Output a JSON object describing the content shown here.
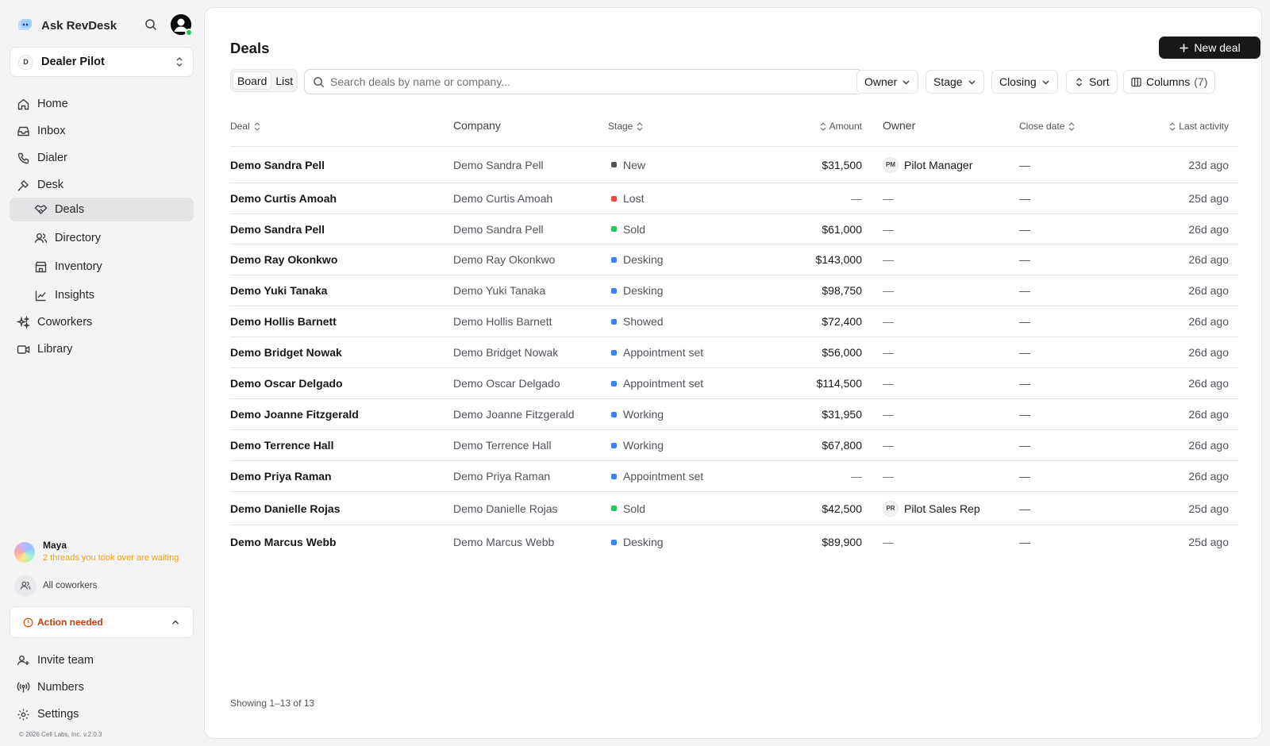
{
  "app": {
    "name": "Ask RevDesk"
  },
  "workspace": {
    "initial": "D",
    "name": "Dealer Pilot"
  },
  "nav": {
    "home": "Home",
    "inbox": "Inbox",
    "dialer": "Dialer",
    "desk": "Desk",
    "deals": "Deals",
    "directory": "Directory",
    "inventory": "Inventory",
    "insights": "Insights",
    "coworkers": "Coworkers",
    "library": "Library"
  },
  "coworker": {
    "name": "Maya",
    "status": "2 threads you took over are waiting"
  },
  "all_coworkers": "All coworkers",
  "action_needed": "Action needed",
  "footer_nav": {
    "invite": "Invite team",
    "numbers": "Numbers",
    "settings": "Settings"
  },
  "copyright": "© 2026 Cell Labs, Inc. v.2.0.3",
  "page": {
    "title": "Deals",
    "new_deal": "New deal",
    "view_board": "Board",
    "view_list": "List",
    "search_placeholder": "Search deals by name or company...",
    "filters": {
      "owner": "Owner",
      "stage": "Stage",
      "closing": "Closing",
      "sort": "Sort",
      "columns": "Columns",
      "columns_count": "(7)"
    }
  },
  "table": {
    "headers": {
      "deal": "Deal",
      "company": "Company",
      "stage": "Stage",
      "amount": "Amount",
      "owner": "Owner",
      "close_date": "Close date",
      "last_activity": "Last activity"
    },
    "rows": [
      {
        "deal": "Demo Sandra Pell",
        "company": "Demo Sandra Pell",
        "stage": "New",
        "stage_color": "#52525b",
        "amount": "$31,500",
        "owner_initials": "PM",
        "owner": "Pilot Manager",
        "close_date": "—",
        "last_activity": "23d ago"
      },
      {
        "deal": "Demo Curtis Amoah",
        "company": "Demo Curtis Amoah",
        "stage": "Lost",
        "stage_color": "#ef4444",
        "amount": "—",
        "owner_initials": "",
        "owner": "—",
        "close_date": "—",
        "last_activity": "25d ago"
      },
      {
        "deal": "Demo Sandra Pell",
        "company": "Demo Sandra Pell",
        "stage": "Sold",
        "stage_color": "#22c55e",
        "amount": "$61,000",
        "owner_initials": "",
        "owner": "—",
        "close_date": "—",
        "last_activity": "26d ago"
      },
      {
        "deal": "Demo Ray Okonkwo",
        "company": "Demo Ray Okonkwo",
        "stage": "Desking",
        "stage_color": "#3b82f6",
        "amount": "$143,000",
        "owner_initials": "",
        "owner": "—",
        "close_date": "—",
        "last_activity": "26d ago"
      },
      {
        "deal": "Demo Yuki Tanaka",
        "company": "Demo Yuki Tanaka",
        "stage": "Desking",
        "stage_color": "#3b82f6",
        "amount": "$98,750",
        "owner_initials": "",
        "owner": "—",
        "close_date": "—",
        "last_activity": "26d ago"
      },
      {
        "deal": "Demo Hollis Barnett",
        "company": "Demo Hollis Barnett",
        "stage": "Showed",
        "stage_color": "#3b82f6",
        "amount": "$72,400",
        "owner_initials": "",
        "owner": "—",
        "close_date": "—",
        "last_activity": "26d ago"
      },
      {
        "deal": "Demo Bridget Nowak",
        "company": "Demo Bridget Nowak",
        "stage": "Appointment set",
        "stage_color": "#3b82f6",
        "amount": "$56,000",
        "owner_initials": "",
        "owner": "—",
        "close_date": "—",
        "last_activity": "26d ago"
      },
      {
        "deal": "Demo Oscar Delgado",
        "company": "Demo Oscar Delgado",
        "stage": "Appointment set",
        "stage_color": "#3b82f6",
        "amount": "$114,500",
        "owner_initials": "",
        "owner": "—",
        "close_date": "—",
        "last_activity": "26d ago"
      },
      {
        "deal": "Demo Joanne Fitzgerald",
        "company": "Demo Joanne Fitzgerald",
        "stage": "Working",
        "stage_color": "#3b82f6",
        "amount": "$31,950",
        "owner_initials": "",
        "owner": "—",
        "close_date": "—",
        "last_activity": "26d ago"
      },
      {
        "deal": "Demo Terrence Hall",
        "company": "Demo Terrence Hall",
        "stage": "Working",
        "stage_color": "#3b82f6",
        "amount": "$67,800",
        "owner_initials": "",
        "owner": "—",
        "close_date": "—",
        "last_activity": "26d ago"
      },
      {
        "deal": "Demo Priya Raman",
        "company": "Demo Priya Raman",
        "stage": "Appointment set",
        "stage_color": "#3b82f6",
        "amount": "—",
        "owner_initials": "",
        "owner": "—",
        "close_date": "—",
        "last_activity": "26d ago"
      },
      {
        "deal": "Demo Danielle Rojas",
        "company": "Demo Danielle Rojas",
        "stage": "Sold",
        "stage_color": "#22c55e",
        "amount": "$42,500",
        "owner_initials": "PR",
        "owner": "Pilot Sales Rep",
        "close_date": "—",
        "last_activity": "25d ago"
      },
      {
        "deal": "Demo Marcus Webb",
        "company": "Demo Marcus Webb",
        "stage": "Desking",
        "stage_color": "#3b82f6",
        "amount": "$89,900",
        "owner_initials": "",
        "owner": "—",
        "close_date": "—",
        "last_activity": "25d ago"
      }
    ],
    "showing": "Showing 1–13 of 13"
  }
}
